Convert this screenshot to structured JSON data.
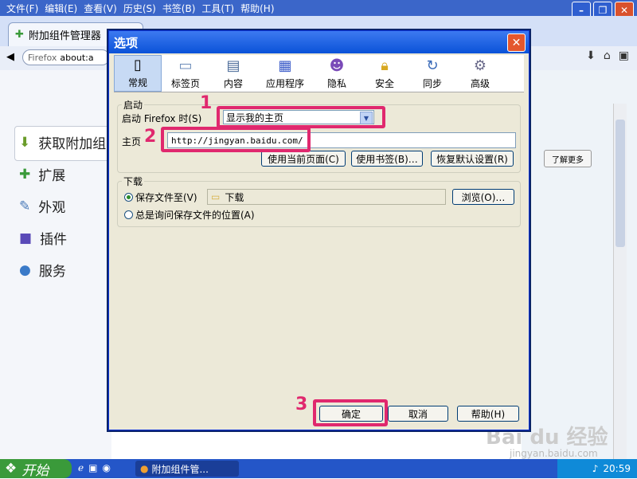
{
  "browser": {
    "menu": [
      "文件(F)",
      "编辑(E)",
      "查看(V)",
      "历史(S)",
      "书签(B)",
      "工具(T)",
      "帮助(H)"
    ],
    "tab_title": "附加组件管理器",
    "url_identity": "Firefox",
    "url_text": "about:a",
    "sidebar": [
      "获取附加组",
      "扩展",
      "外观",
      "插件",
      "服务"
    ],
    "learn_more": "了解更多"
  },
  "dialog": {
    "title": "选项",
    "tabs": [
      "常规",
      "标签页",
      "内容",
      "应用程序",
      "隐私",
      "安全",
      "同步",
      "高级"
    ],
    "startup": {
      "group_label": "启动",
      "when_label": "启动 Firefox 时(S)",
      "when_value": "显示我的主页",
      "homepage_label": "主页",
      "homepage_value": "http://jingyan.baidu.com/",
      "btn_current": "使用当前页面(C)",
      "btn_bookmark": "使用书签(B)…",
      "btn_default": "恢复默认设置(R)"
    },
    "download": {
      "group_label": "下载",
      "save_to_label": "保存文件至(V)",
      "folder": "下载",
      "browse": "浏览(O)…",
      "always_ask": "总是询问保存文件的位置(A)"
    },
    "footer": {
      "ok": "确定",
      "cancel": "取消",
      "help": "帮助(H)"
    }
  },
  "annotations": {
    "n1": "1",
    "n2": "2",
    "n3": "3",
    "color": "#e0286e"
  },
  "taskbar": {
    "start": "开始",
    "task_item": "附加组件管...",
    "clock": "20:59"
  },
  "watermark": {
    "brand": "Bai du 经验",
    "url": "jingyan.baidu.com"
  }
}
